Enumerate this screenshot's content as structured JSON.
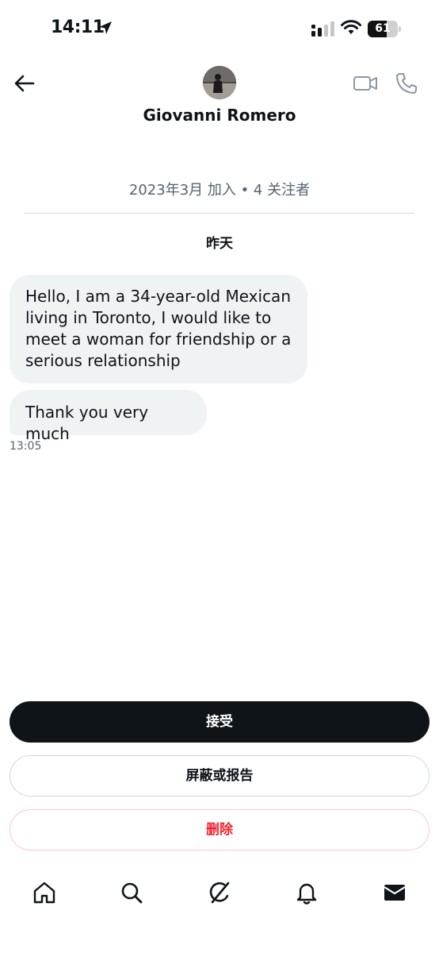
{
  "status_bar": {
    "time": "14:11",
    "battery_level": "61",
    "icons": [
      "location-arrow-icon",
      "cellular-signal-icon",
      "wifi-icon",
      "battery-icon"
    ]
  },
  "header": {
    "contact_name": "Giovanni Romero",
    "icons": [
      "back-arrow-icon",
      "avatar",
      "video-call-icon",
      "phone-call-icon"
    ]
  },
  "conversation": {
    "profile_info": "2023年3月 加入 • 4 关注者",
    "day_label": "昨天",
    "messages": [
      {
        "text": "Hello, I am a 34-year-old Mexican living in Toronto, I would like to meet a woman for friendship or a serious relationship"
      },
      {
        "text": "Thank you very much"
      }
    ],
    "last_time": "13:05"
  },
  "actions": {
    "accept_label": "接受",
    "block_report_label": "屏蔽或报告",
    "delete_label": "删除"
  },
  "tab_bar": {
    "items": [
      "home-icon",
      "search-icon",
      "grok-icon",
      "notifications-bell-icon",
      "messages-envelope-icon"
    ]
  },
  "colors": {
    "text_primary": "#0f1419",
    "text_secondary": "#536471",
    "bubble_bg": "#eff3f4",
    "danger": "#f4212e",
    "border": "#cfd9de"
  }
}
